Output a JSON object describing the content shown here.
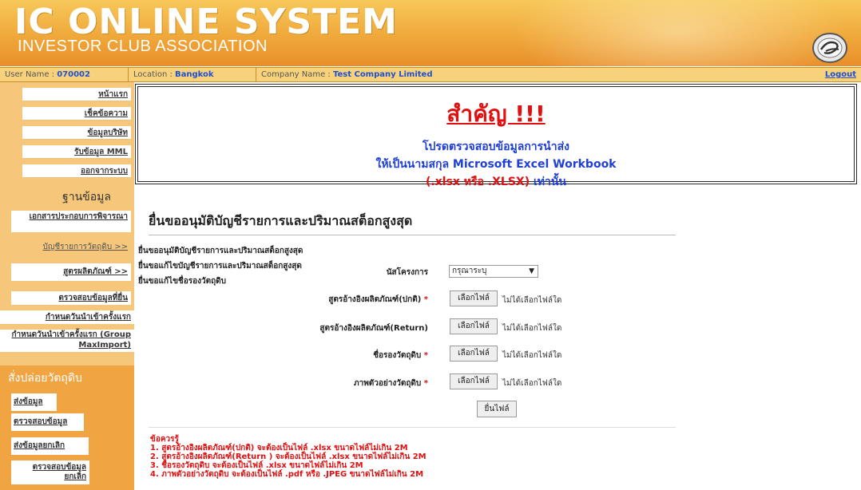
{
  "header": {
    "title": "IC ONLINE SYSTEM",
    "subtitle": "INVESTOR CLUB ASSOCIATION",
    "logo_icon": "boi-seal-icon"
  },
  "infobar": {
    "user_label": "User Name : ",
    "user_value": "070002",
    "location_label": "Location : ",
    "location_value": "Bangkok",
    "company_label": "Company Name : ",
    "company_value": "Test Company Limited",
    "logout": "Logout"
  },
  "sidebar": {
    "top_items": [
      "หน้าแรก",
      "เช็คข้อความ",
      "ข้อมูลบริษัท",
      "รับข้อมูล MML",
      "ออกจากระบบ"
    ],
    "section1_title": "ฐานข้อมูล",
    "section1_items": [
      "เอกสารประกอบการพิจารณา",
      "บัญชีรายการวัตถุดิบ >>",
      "สูตรผลิตภัณฑ์ >>",
      "ตรวจสอบข้อมูลที่ยื่น",
      "กำหนดวันนำเข้าครั้งแรก",
      "กำหนดวันนำเข้าครั้งแรก (Group MaxImport)"
    ],
    "section2_title": "สั่งปล่อยวัตถุดิบ",
    "section2_items": [
      "ส่งข้อมูล",
      "ตรวจสอบข้อมูล",
      "ส่งข้อมูลยกเลิก",
      "ตรวจสอบข้อมูลยกเลิก"
    ]
  },
  "alert": {
    "title": "สำคัญ !!!",
    "line1": "โปรดตรวจสอบข้อมูลการนำส่ง",
    "line2": "ให้เป็นนามสกุล Microsoft Excel Workbook",
    "line3_red": "(.xlsx หรือ .XLSX)",
    "line3_blue": " เท่านั้น"
  },
  "form": {
    "title": "ยื่นขออนุมัติบัญชีรายการและปริมาณสต็อกสูงสุด",
    "links": [
      "ยื่นขออนุมัติบัญชีรายการและปริมาณสต็อกสูงสุด",
      "ยื่นขอแก้ไขบัญชีรายการและปริมาณสต็อกสูงสุด",
      "ยื่นขอแก้ไขชื่อรองวัตถุดิบ"
    ],
    "project_label": "นัสโครงการ",
    "project_value": "กรุณาระบุ",
    "fields": [
      {
        "label": "สูตรอ้างอิงผลิตภัณฑ์(ปกติ)",
        "required": "*"
      },
      {
        "label": "สูตรอ้างอิงผลิตภัณฑ์(Return)",
        "required": ""
      },
      {
        "label": "ชื่อรองวัตถุดิบ",
        "required": "*"
      },
      {
        "label": "ภาพตัวอย่างวัตถุดิบ",
        "required": "*"
      }
    ],
    "file_button": "เลือกไฟล์",
    "no_file": "ไม่ได้เลือกไฟล์ใด",
    "submit": "ยื่นไฟล์"
  },
  "notes": {
    "title": "ข้อควรรู้",
    "items": [
      "1. สูตรอ้างอิงผลิตภัณฑ์(ปกติ) จะต้องเป็นไฟล์ .xlsx ขนาดไฟล์ไม่เกิน 2M",
      "2. สูตรอ้างอิงผลิตภัณฑ์(Return ) จะต้องเป็นไฟล์ .xlsx ขนาดไฟล์ไม่เกิน 2M",
      "3. ชื่อรองวัตถุดิบ จะต้องเป็นไฟล์ .xlsx ขนาดไฟล์ไม่เกิน 2M",
      "4. ภาพตัวอย่างวัตถุดิบ จะต้องเป็นไฟล์ .pdf หรือ .JPEG ขนาดไฟล์ไม่เกิน 2M"
    ]
  }
}
